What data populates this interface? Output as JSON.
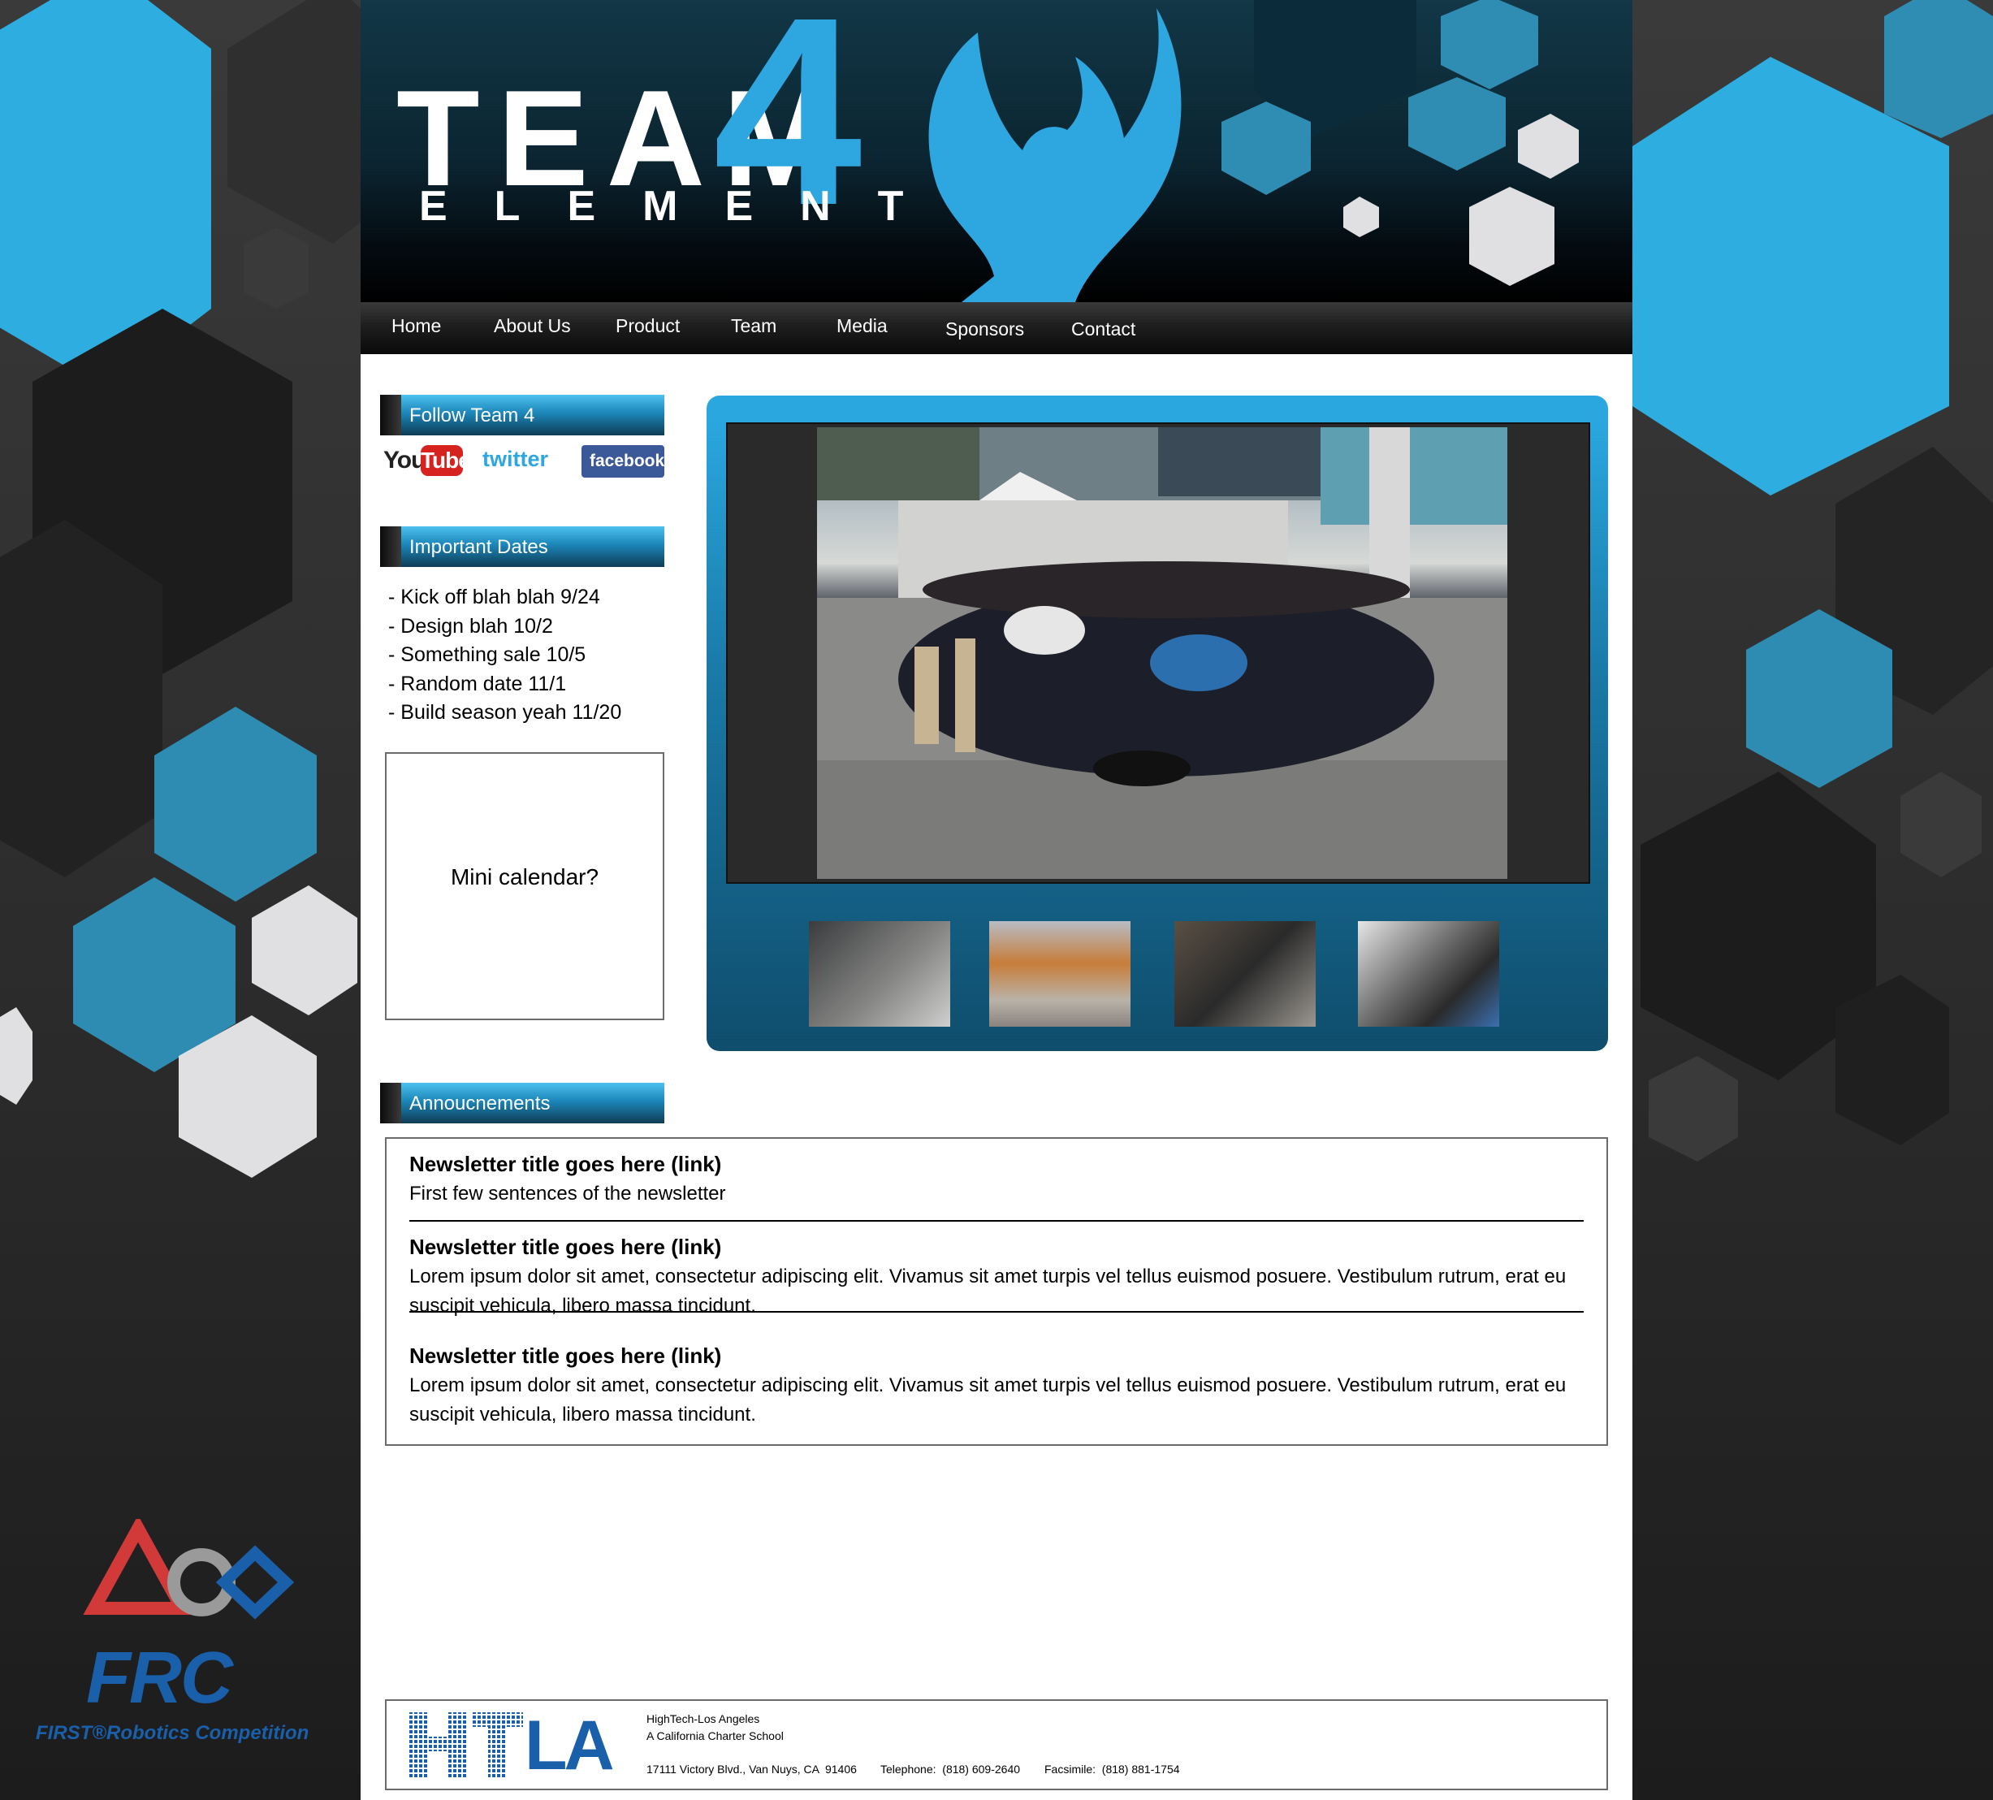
{
  "header": {
    "logo_team": "TEAM",
    "logo_number": "4",
    "logo_element": "ELEMENT"
  },
  "nav": {
    "items": [
      "Home",
      "About Us",
      "Product",
      "Team",
      "Media",
      "Sponsors",
      "Contact"
    ]
  },
  "sidebar": {
    "follow_heading": "Follow Team 4",
    "social": [
      "YouTube",
      "twitter",
      "facebook"
    ],
    "dates_heading": "Important Dates",
    "dates": [
      "- Kick off blah blah 9/24",
      "- Design blah 10/2",
      "- Something sale 10/5",
      "- Random date 11/1",
      "- Build season yeah 11/20"
    ],
    "calendar_placeholder": "Mini calendar?"
  },
  "announcements": {
    "heading": "Annoucnements",
    "items": [
      {
        "title": "Newsletter title goes here (link)",
        "body": "First few sentences of the newsletter"
      },
      {
        "title": "Newsletter title goes here (link)",
        "body": "Lorem ipsum dolor sit amet, consectetur adipiscing elit. Vivamus sit amet turpis vel tellus euismod posuere. Vestibulum rutrum, erat eu suscipit vehicula, libero massa tincidunt."
      },
      {
        "title": "Newsletter title goes here (link)",
        "body": "Lorem ipsum dolor sit amet, consectetur adipiscing elit. Vivamus sit amet turpis vel tellus euismod posuere. Vestibulum rutrum, erat eu suscipit vehicula, libero massa tincidunt."
      }
    ]
  },
  "footer": {
    "logo": "HTLA",
    "school_name": "HighTech-Los Angeles",
    "school_type": "A California Charter School",
    "address": "17111 Victory Blvd., Van Nuys, CA  91406",
    "telephone": "Telephone:  (818) 609-2640",
    "facsimile": "Facsimile:  (818) 881-1754"
  },
  "frc": {
    "logo_text": "FRC",
    "subtitle": "FIRST®Robotics Competition"
  },
  "colors": {
    "accent_blue": "#2ea6df",
    "frc_blue": "#1a5faa",
    "background_dark": "#242424"
  }
}
